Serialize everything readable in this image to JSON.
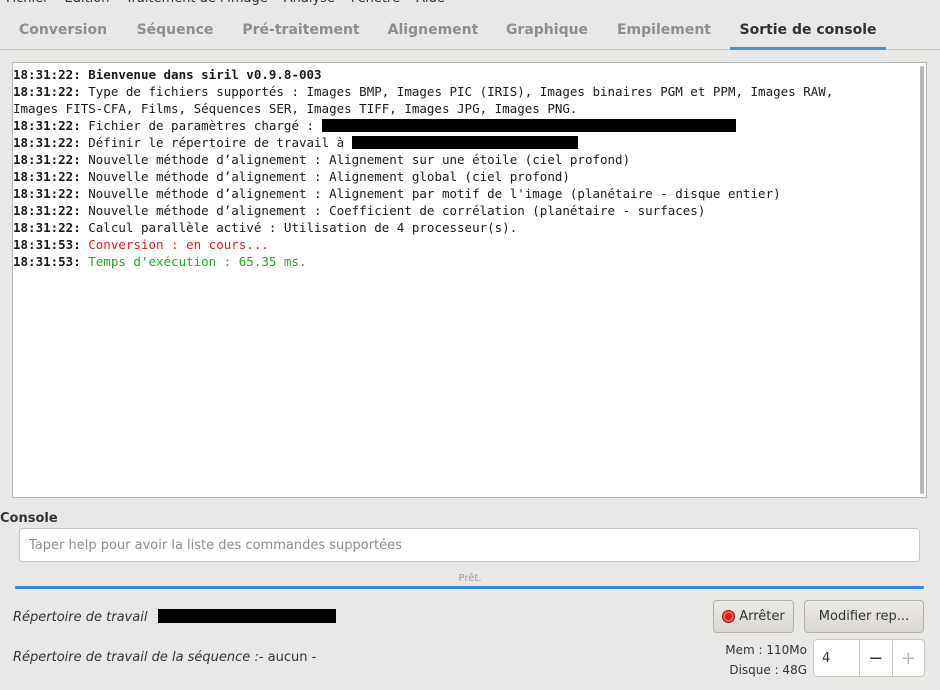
{
  "menu": [
    "Fichier",
    "Edition",
    "Traitement de l'image",
    "Analyse",
    "Fenêtre",
    "Aide"
  ],
  "tabs": [
    {
      "label": "Conversion",
      "active": false
    },
    {
      "label": "Séquence",
      "active": false
    },
    {
      "label": "Pré-traitement",
      "active": false
    },
    {
      "label": "Alignement",
      "active": false
    },
    {
      "label": "Graphique",
      "active": false
    },
    {
      "label": "Empilement",
      "active": false
    },
    {
      "label": "Sortie de console",
      "active": true
    }
  ],
  "log": [
    {
      "time": "18:31:22:",
      "text": " Bienvenue dans siril v0.9.8-003",
      "style": "bold"
    },
    {
      "time": "18:31:22:",
      "text": " Type de fichiers supportés : Images BMP, Images PIC (IRIS), Images binaires PGM et PPM, Images RAW,",
      "style": "normal"
    },
    {
      "time": "",
      "text": "Images FITS-CFA, Films, Séquences SER, Images TIFF, Images JPG, Images PNG.",
      "style": "normal"
    },
    {
      "time": "18:31:22:",
      "text": " Fichier de paramètres chargé : ",
      "style": "normal",
      "redacted": true
    },
    {
      "time": "18:31:22:",
      "text": " Définir le répertoire de travail à ",
      "style": "normal",
      "redacted": true
    },
    {
      "time": "18:31:22:",
      "text": " Nouvelle méthode d’alignement : Alignement sur une étoile (ciel profond)",
      "style": "normal"
    },
    {
      "time": "18:31:22:",
      "text": " Nouvelle méthode d’alignement : Alignement global (ciel profond)",
      "style": "normal"
    },
    {
      "time": "18:31:22:",
      "text": " Nouvelle méthode d’alignement : Alignement par motif de l'image (planétaire - disque entier)",
      "style": "normal"
    },
    {
      "time": "18:31:22:",
      "text": " Nouvelle méthode d’alignement : Coefficient de corrélation (planétaire - surfaces)",
      "style": "normal"
    },
    {
      "time": "18:31:22:",
      "text": " Calcul parallèle activé : Utilisation de 4 processeur(s).",
      "style": "normal"
    },
    {
      "time": "18:31:53:",
      "text": " Conversion : en cours...",
      "style": "red"
    },
    {
      "time": "18:31:53:",
      "text": " Temps d'exécution : 65.35 ms.",
      "style": "green"
    }
  ],
  "console": {
    "label": "Console",
    "placeholder": "Taper help pour avoir la liste des commandes supportées"
  },
  "status": {
    "text": "Prêt.",
    "progress": 1.0
  },
  "footer": {
    "workdir_label": "Répertoire de travail",
    "seq_workdir_label": "Répertoire de travail de la séquence :",
    "seq_workdir_value": "- aucun -",
    "stop_label": "Arrêter",
    "modify_label": "Modifier rep...",
    "mem": "Mem : 110Mo",
    "disk": "Disque : 48G",
    "threads": "4"
  },
  "colors": {
    "accent": "#4a90d9",
    "error": "#e01b24",
    "success": "#26a625"
  }
}
